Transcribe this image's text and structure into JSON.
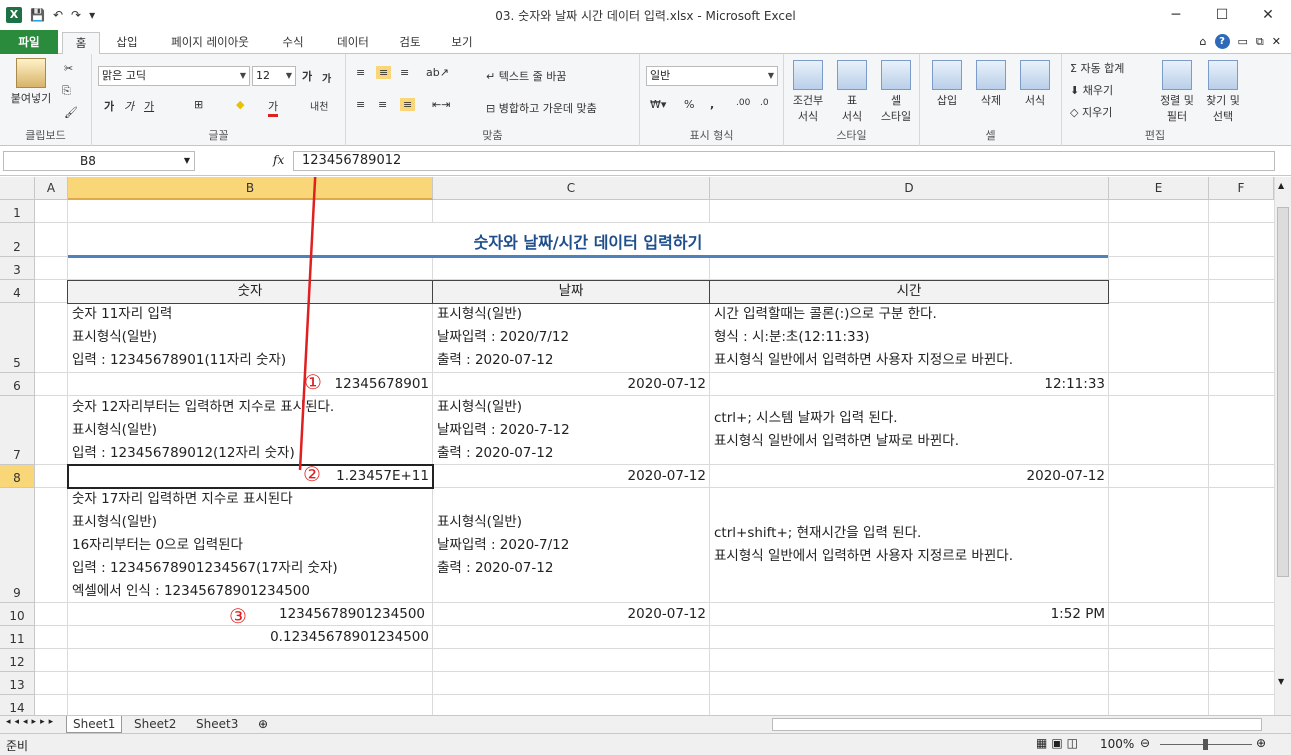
{
  "window": {
    "title": "03. 숫자와 날짜 시간 데이터 입력.xlsx - Microsoft Excel",
    "controls": {
      "minimize": "─",
      "maximize": "☐",
      "close": "✕"
    }
  },
  "qat": {
    "logo": "X",
    "save": "💾",
    "undo": "↶",
    "redo": "↷",
    "customize": "▾"
  },
  "tabs": [
    {
      "label": "파일"
    },
    {
      "label": "홈"
    },
    {
      "label": "삽입"
    },
    {
      "label": "페이지 레이아웃"
    },
    {
      "label": "수식"
    },
    {
      "label": "데이터"
    },
    {
      "label": "검토"
    },
    {
      "label": "보기"
    }
  ],
  "tabs_right": {
    "caret": "⌂",
    "help": "?",
    "minimize": "▭",
    "restore": "⧉",
    "close": "✕"
  },
  "ribbon": {
    "clipboard": {
      "label": "클립보드",
      "paste": "붙여넣기"
    },
    "font": {
      "label": "글꼴",
      "name": "맑은 고딕",
      "size": "12",
      "grow": "가",
      "shrink": "가",
      "bold": "가",
      "italic": "가",
      "underline": "가",
      "border": "⊞",
      "fill": "◆",
      "color": "가",
      "phonetic": "내천"
    },
    "align": {
      "label": "맞춤",
      "wrap": "텍스트 줄 바꿈",
      "merge": "병합하고 가운데 맞춤"
    },
    "number": {
      "label": "표시 형식",
      "format": "일반",
      "percent": "%",
      "comma": ","
    },
    "styles": {
      "label": "스타일",
      "cond": "조건부\n서식",
      "table": "표\n서식",
      "cell": "셀\n스타일"
    },
    "cells": {
      "label": "셀",
      "insert": "삽입",
      "delete": "삭제",
      "format": "서식"
    },
    "edit": {
      "label": "편집",
      "autosum": "Σ 자동 합계",
      "fill": "채우기",
      "clear": "지우기",
      "sort": "정렬 및\n필터",
      "find": "찾기 및\n선택"
    }
  },
  "formula_bar": {
    "name_box": "B8",
    "fx": "fx",
    "value": "123456789012"
  },
  "columns": [
    "A",
    "B",
    "C",
    "D",
    "E",
    "F"
  ],
  "rows": [
    "1",
    "2",
    "3",
    "4",
    "5",
    "6",
    "7",
    "8",
    "9",
    "10",
    "11",
    "12",
    "13",
    "14"
  ],
  "sheet": {
    "title": "숫자와 날짜/시간 데이터 입력하기",
    "headers": {
      "b": "숫자",
      "c": "날짜",
      "d": "시간"
    },
    "r5": {
      "b": [
        "숫자 11자리 입력",
        "표시형식(일반)",
        "입력 : 12345678901(11자리 숫자)"
      ],
      "c": [
        "표시형식(일반)",
        "날짜입력 : 2020/7/12",
        "출력 : 2020-07-12"
      ],
      "d": [
        "시간 입력할때는 콜론(:)으로 구분 한다.",
        "형식 : 시:분:초(12:11:33)",
        "표시형식 일반에서 입력하면 사용자 지정으로 바뀐다."
      ]
    },
    "r6": {
      "b": "12345678901",
      "c": "2020-07-12",
      "d": "12:11:33"
    },
    "r7": {
      "b": [
        "숫자 12자리부터는 입력하면 지수로 표시된다.",
        "표시형식(일반)",
        "입력 : 123456789012(12자리 숫자)"
      ],
      "c": [
        "표시형식(일반)",
        "날짜입력 : 2020-7-12",
        "출력 : 2020-07-12"
      ],
      "d": [
        "ctrl+; 시스템 날짜가 입력 된다.",
        "표시형식 일반에서 입력하면 날짜로 바뀐다."
      ]
    },
    "r8": {
      "b": "1.23457E+11",
      "c": "2020-07-12",
      "d": "2020-07-12"
    },
    "r9": {
      "b": [
        "숫자 17자리 입력하면 지수로 표시된다",
        "표시형식(일반)",
        "16자리부터는 0으로 입력된다",
        "입력 : 12345678901234567(17자리 숫자)",
        "엑셀에서 인식 : 12345678901234500"
      ],
      "c": [
        "표시형식(일반)",
        "날짜입력 : 2020-7/12",
        "출력 : 2020-07-12"
      ],
      "d": [
        "ctrl+shift+; 현재시간을 입력 된다.",
        "표시형식 일반에서 입력하면 사용자 지정르로 바뀐다."
      ]
    },
    "r10": {
      "b": "12345678901234500",
      "c": "2020-07-12",
      "d": "1:52 PM"
    },
    "r11": {
      "b": "0.12345678901234500"
    },
    "markers": {
      "one": "①",
      "two": "②",
      "three": "③"
    },
    "arrow_color": "#e02020"
  },
  "sheet_tabs": [
    "Sheet1",
    "Sheet2",
    "Sheet3"
  ],
  "status": {
    "ready": "준비",
    "zoom": "100%"
  }
}
